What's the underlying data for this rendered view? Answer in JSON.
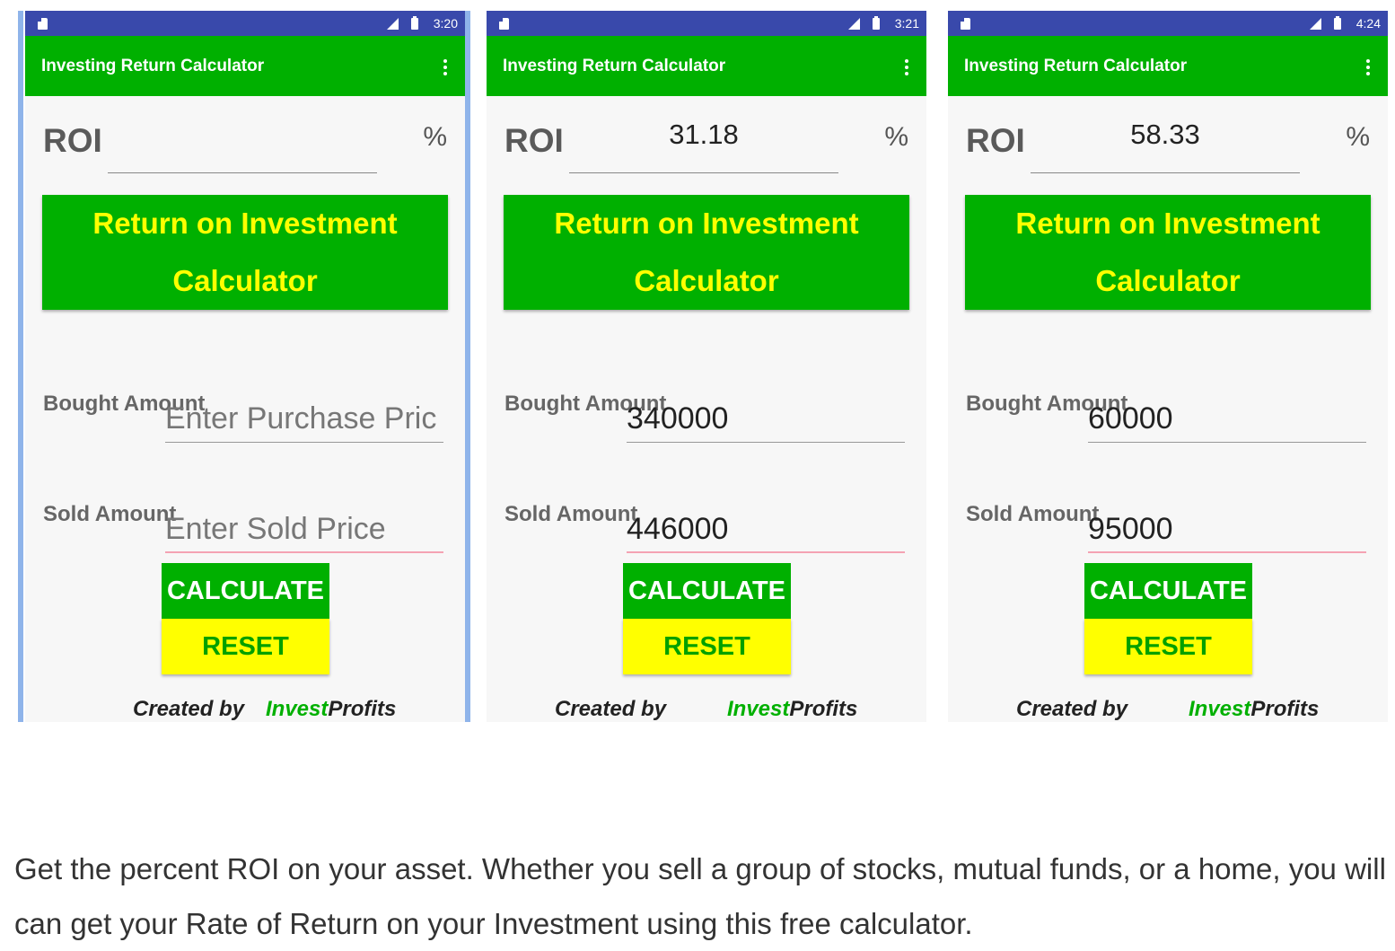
{
  "app": {
    "title": "Investing Return Calculator",
    "banner": "Return on Investment Calculator",
    "roi_label": "ROI",
    "percent_symbol": "%",
    "bought_label": "Bought Amount",
    "sold_label": "Sold Amount",
    "calculate_label": "CALCULATE",
    "reset_label": "RESET",
    "created_by": "Created by",
    "brand_part1": "Invest",
    "brand_part2": "Profits"
  },
  "screens": [
    {
      "time": "3:20",
      "roi": "",
      "bought_value": "",
      "bought_placeholder": "Enter Purchase Pric",
      "sold_value": "",
      "sold_placeholder": "Enter Sold Price"
    },
    {
      "time": "3:21",
      "roi": "31.18",
      "bought_value": "340000",
      "bought_placeholder": "",
      "sold_value": "446000",
      "sold_placeholder": ""
    },
    {
      "time": "4:24",
      "roi": "58.33",
      "bought_value": "60000",
      "bought_placeholder": "",
      "sold_value": "95000",
      "sold_placeholder": ""
    }
  ],
  "description": "Get the percent ROI on your asset. Whether you sell a group of stocks, mutual funds, or a home, you will can get your Rate of Return on your Investment using this free calculator.",
  "colors": {
    "status_bar": "#3949ab",
    "app_green": "#00b000",
    "banner_text": "#ffff00",
    "reset_bg": "#ffff00"
  }
}
